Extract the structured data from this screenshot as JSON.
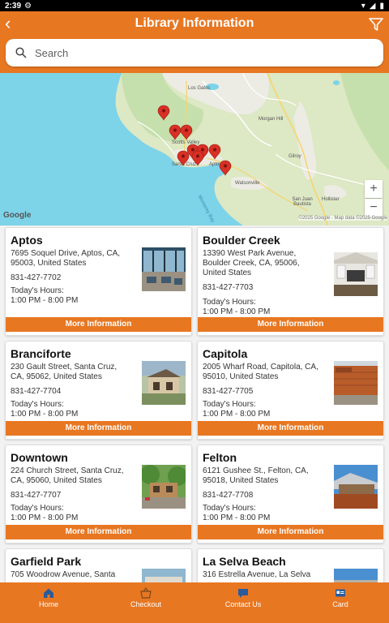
{
  "status": {
    "time": "2:39"
  },
  "header": {
    "title": "Library Information"
  },
  "search": {
    "placeholder": "Search"
  },
  "map": {
    "labels": [
      "Los Gatos",
      "Morgan Hill",
      "Scotts Valley",
      "Santa Cruz",
      "Aptos",
      "Gilroy",
      "Watsonville",
      "San Juan Bautista",
      "Hollister",
      "Monterey Bay"
    ],
    "attribution": "©2025 Google · Map data ©2025 Google",
    "logo": "Google",
    "zoom_in": "+",
    "zoom_out": "−"
  },
  "libraries": [
    {
      "name": "Aptos",
      "address": "7695 Soquel Drive, Aptos, CA, 95003, United States",
      "phone": "831-427-7702",
      "hours_label": "Today's Hours:",
      "hours": "1:00 PM - 8:00 PM",
      "button": "More Information"
    },
    {
      "name": "Boulder Creek",
      "address": "13390 West Park Avenue, Boulder Creek, CA, 95006, United States",
      "phone": "831-427-7703",
      "hours_label": "Today's Hours:",
      "hours": "1:00 PM - 8:00 PM",
      "button": "More Information"
    },
    {
      "name": "Branciforte",
      "address": "230 Gault Street, Santa Cruz, CA, 95062, United States",
      "phone": "831-427-7704",
      "hours_label": "Today's Hours:",
      "hours": "1:00 PM - 8:00 PM",
      "button": "More Information"
    },
    {
      "name": "Capitola",
      "address": "2005 Wharf Road, Capitola, CA, 95010, United States",
      "phone": "831-427-7705",
      "hours_label": "Today's Hours:",
      "hours": "1:00 PM - 8:00 PM",
      "button": "More Information"
    },
    {
      "name": "Downtown",
      "address": "224 Church Street, Santa Cruz, CA, 95060, United States",
      "phone": "831-427-7707",
      "hours_label": "Today's Hours:",
      "hours": "1:00 PM - 8:00 PM",
      "button": "More Information"
    },
    {
      "name": "Felton",
      "address": "6121 Gushee St., Felton, CA, 95018, United States",
      "phone": "831-427-7708",
      "hours_label": "Today's Hours:",
      "hours": "1:00 PM - 8:00 PM",
      "button": "More Information"
    },
    {
      "name": "Garfield Park",
      "address": "705 Woodrow Avenue, Santa"
    },
    {
      "name": "La Selva Beach",
      "address": "316 Estrella Avenue, La Selva"
    }
  ],
  "nav": {
    "home": "Home",
    "checkout": "Checkout",
    "contact": "Contact Us",
    "card": "Card"
  },
  "colors": {
    "accent": "#e87722",
    "pin": "#d93025"
  }
}
